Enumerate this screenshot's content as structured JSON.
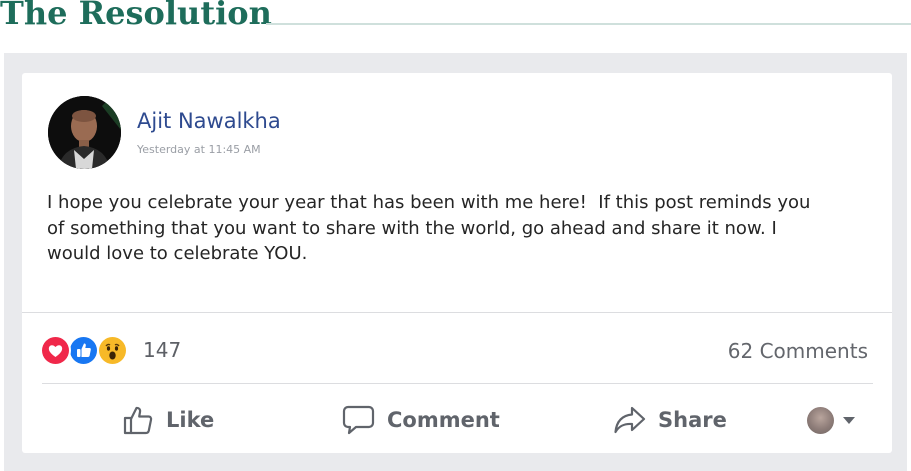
{
  "page": {
    "heading": "The Resolution"
  },
  "post": {
    "author": "Ajit Nawalkha",
    "timestamp": "Yesterday at 11:45 AM",
    "text": "I hope you celebrate your year that has been with me here!  If this post reminds you\nof something that you want to share with the world, go ahead and share it now. I\nwould love to celebrate YOU."
  },
  "stats": {
    "reaction_icons": [
      "love-icon",
      "like-icon",
      "wow-icon"
    ],
    "reaction_count": "147",
    "comments_label": "62 Comments"
  },
  "actions": {
    "like": "Like",
    "comment": "Comment",
    "share": "Share"
  },
  "colors": {
    "heading": "#1e6d5b",
    "author": "#2e4a8f",
    "frame": "#e9eaed",
    "love": "#f0284a",
    "like": "#1877f2",
    "wow": "#f7b928"
  }
}
